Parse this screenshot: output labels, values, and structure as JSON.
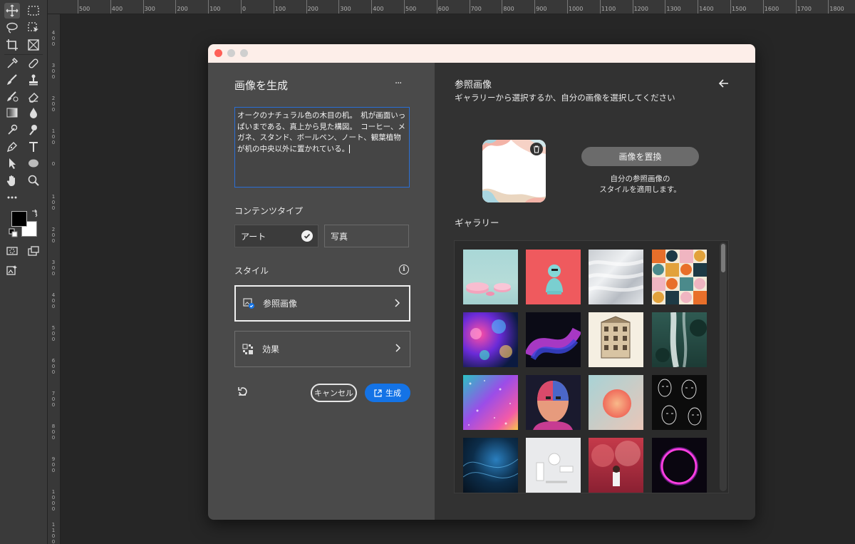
{
  "ruler": {
    "h_labels": [
      "500",
      "400",
      "300",
      "200",
      "100",
      "0",
      "100",
      "200",
      "300",
      "400",
      "500",
      "600",
      "700",
      "800",
      "900",
      "1000",
      "1100",
      "1200",
      "1300",
      "1400",
      "1500",
      "1600",
      "1700",
      "1800"
    ],
    "v_labels": [
      "4\n0\n0",
      "3\n0\n0",
      "2\n0\n0",
      "1\n0\n0",
      "0",
      "1\n0\n0",
      "2\n0\n0",
      "3\n0\n0",
      "4\n0\n0",
      "5\n0\n0",
      "6\n0\n0",
      "7\n0\n0",
      "8\n0\n0",
      "9\n0\n0",
      "1\n0\n0\n0",
      "1\n1\n0\n0"
    ]
  },
  "dialog": {
    "title": "画像を生成",
    "more_label": "···",
    "prompt": "オークのナチュラル色の木目の机。　机が画面いっぱいまである、真上から見た構図。　コーヒー、メガネ、スタンド、ボールペン、ノート、観葉植物が机の中央以外に置かれている。",
    "content_type_label": "コンテンツタイプ",
    "content_types": [
      "アート",
      "写真"
    ],
    "selected_content_type": "アート",
    "style_label": "スタイル",
    "style_cards": [
      {
        "label": "参照画像"
      },
      {
        "label": "効果"
      }
    ],
    "cancel_label": "キャンセル",
    "generate_label": "生成"
  },
  "reference": {
    "title": "参照画像",
    "subtitle": "ギャラリーから選択するか、自分の画像を選択してください",
    "replace_label": "画像を置換",
    "hint_line1": "自分の参照画像の",
    "hint_line2": "スタイルを適用します。",
    "gallery_label": "ギャラリー"
  },
  "colors": {
    "accent": "#1473e6",
    "close": "#fe5f57",
    "minimize": "#cfcfcf",
    "zoom": "#cfcfcf"
  }
}
